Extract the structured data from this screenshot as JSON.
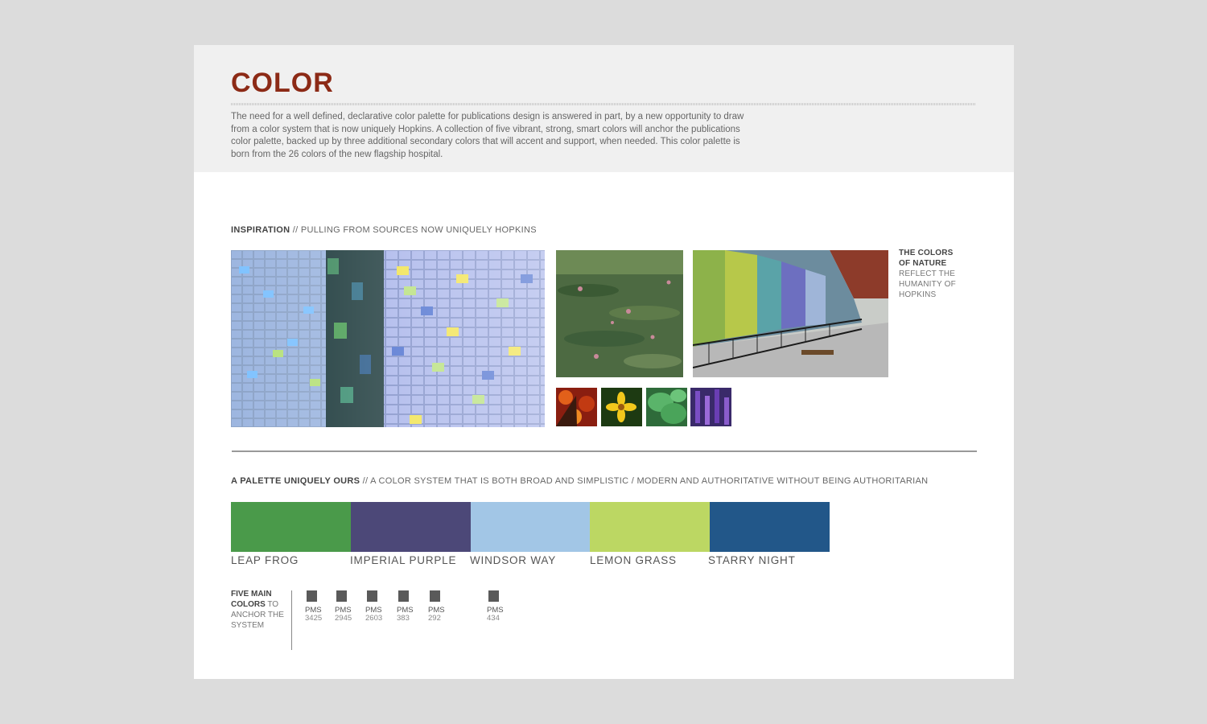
{
  "page": {
    "title": "COLOR",
    "intro": "The need for a well defined, declarative color palette for publications design is answered in part, by a new opportunity to draw from a color system that is now uniquely Hopkins. A collection of five vibrant, strong, smart colors will anchor the publications color palette, backed up by three additional secondary colors that will accent and support, when needed. This color palette is born from the 26 colors of the new flagship hospital."
  },
  "inspiration": {
    "label_bold": "INSPIRATION",
    "label_rest": "// PULLING FROM SOURCES NOW UNIQUELY HOPKINS",
    "caption_bold_1": "THE COLORS",
    "caption_bold_2": "OF NATURE",
    "caption_rest_1": "REFLECT THE",
    "caption_rest_2": "HUMANITY OF",
    "caption_rest_3": "HOPKINS"
  },
  "palette": {
    "label_bold": "A PALETTE UNIQUELY OURS",
    "label_rest": "// A COLOR SYSTEM THAT IS BOTH BROAD AND SIMPLISTIC / MODERN AND AUTHORITATIVE WITHOUT BEING AUTHORITARIAN",
    "colors": [
      {
        "name": "LEAP FROG",
        "hex": "#4a9a4a"
      },
      {
        "name": "IMPERIAL PURPLE",
        "hex": "#4c4878"
      },
      {
        "name": "WINDSOR WAY",
        "hex": "#a2c6e6"
      },
      {
        "name": "LEMON GRASS",
        "hex": "#bcd763"
      },
      {
        "name": "STARRY NIGHT",
        "hex": "#225789"
      }
    ],
    "anchor_bold_1": "FIVE MAIN",
    "anchor_bold_2": "COLORS",
    "anchor_rest_1": " TO",
    "anchor_rest_2": "ANCHOR THE",
    "anchor_rest_3": "SYSTEM",
    "pms": [
      {
        "label": "PMS",
        "number": "3425"
      },
      {
        "label": "PMS",
        "number": "2945"
      },
      {
        "label": "PMS",
        "number": "2603"
      },
      {
        "label": "PMS",
        "number": "383"
      },
      {
        "label": "PMS",
        "number": "292"
      },
      {
        "label": "PMS",
        "number": "434"
      }
    ]
  },
  "theme": {
    "title_color": "#8c2a16",
    "background": "#dcdcdc",
    "header_band": "#f0f0f0"
  }
}
